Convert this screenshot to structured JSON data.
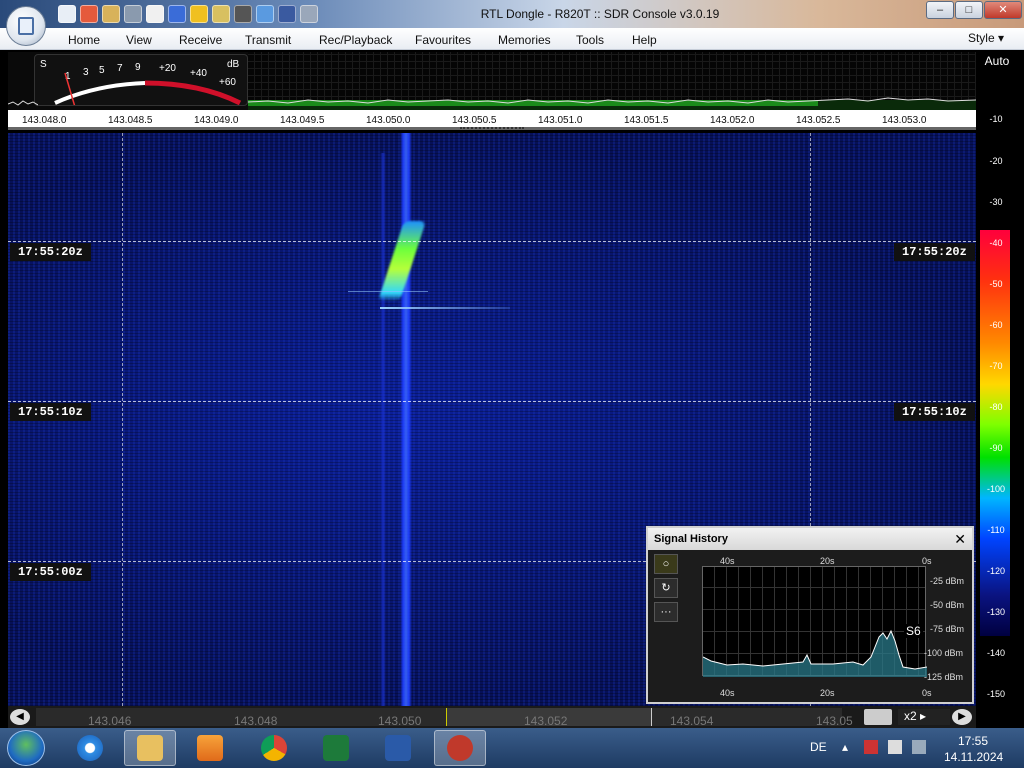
{
  "window": {
    "title": "RTL Dongle - R820T :: SDR Console v3.0.19",
    "minimize": "–",
    "maximize": "□",
    "close": "✕"
  },
  "menu": {
    "items": [
      "Home",
      "View",
      "Receive",
      "Transmit",
      "Rec/Playback",
      "Favourites",
      "Memories",
      "Tools",
      "Help"
    ],
    "style": "Style"
  },
  "meter": {
    "s_label": "S",
    "scale": [
      "1",
      "3",
      "5",
      "7",
      "9",
      "+20",
      "+40",
      "+60"
    ],
    "db_label": "dB"
  },
  "frequency_axis": [
    "143.048.0",
    "143.048.5",
    "143.049.0",
    "143.049.5",
    "143.050.0",
    "143.050.5",
    "143.051.0",
    "143.051.5",
    "143.052.0",
    "143.052.5",
    "143.053.0"
  ],
  "level_scale": {
    "auto_label": "Auto",
    "ticks": [
      "-10",
      "-20",
      "-30",
      "-40",
      "-50",
      "-60",
      "-70",
      "-80",
      "-90",
      "-100",
      "-110",
      "-120",
      "-130",
      "-140",
      "-150"
    ]
  },
  "waterfall": {
    "timestamps": [
      "17:55:20z",
      "17:55:10z",
      "17:55:00z"
    ]
  },
  "bottom_axis": {
    "labels": [
      "143.046",
      "143.048",
      "143.050",
      "143.052",
      "143.054",
      "143.05"
    ],
    "zoom": "x2"
  },
  "signal_history": {
    "title": "Signal History",
    "close": "✕",
    "time_top": [
      "40s",
      "20s",
      "0s"
    ],
    "time_bottom": [
      "40s",
      "20s",
      "0s"
    ],
    "db_labels": [
      "-25 dBm",
      "-50 dBm",
      "-75 dBm",
      "-100 dBm",
      "-125 dBm"
    ],
    "s_reading": "S6",
    "side_buttons": [
      "○",
      "↻",
      "···"
    ]
  },
  "taskbar": {
    "apps": [
      "internet-explorer",
      "file-explorer",
      "media-player",
      "chrome",
      "excel",
      "word",
      "sdr-console"
    ],
    "language": "DE",
    "time": "17:55",
    "date": "14.11.2024"
  },
  "colors": {
    "waterfall_bg": "#07145e",
    "signal": "#6dff3c",
    "titlebar": "#2a4a7a"
  }
}
